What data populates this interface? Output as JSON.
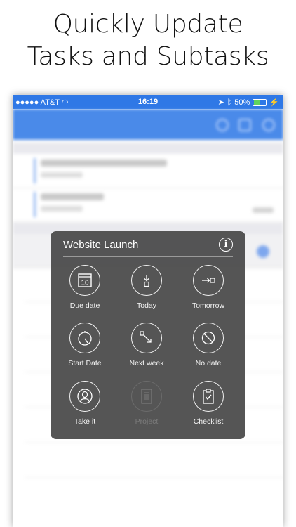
{
  "headline": {
    "line1": "Quickly Update",
    "line2": "Tasks and Subtasks"
  },
  "status_bar": {
    "carrier": "●●●●● AT&T",
    "time": "16:19",
    "battery": "50%"
  },
  "popup": {
    "title": "Website Launch",
    "actions": [
      {
        "label": "Due date",
        "icon": "calendar-icon",
        "icon_text": "10",
        "enabled": true
      },
      {
        "label": "Today",
        "icon": "arrow-down-box-icon",
        "enabled": true
      },
      {
        "label": "Tomorrow",
        "icon": "arrow-right-box-icon",
        "enabled": true
      },
      {
        "label": "Start Date",
        "icon": "stopwatch-icon",
        "enabled": true
      },
      {
        "label": "Next week",
        "icon": "diagonal-arrow-icon",
        "enabled": true
      },
      {
        "label": "No date",
        "icon": "prohibited-icon",
        "enabled": true
      },
      {
        "label": "Take it",
        "icon": "person-icon",
        "enabled": true
      },
      {
        "label": "Project",
        "icon": "document-icon",
        "enabled": false
      },
      {
        "label": "Checklist",
        "icon": "clipboard-check-icon",
        "enabled": true
      }
    ]
  },
  "colors": {
    "status_bar_bg": "#2f78e6",
    "popup_bg": "#484848",
    "disabled_text": "#7b7b7b"
  }
}
